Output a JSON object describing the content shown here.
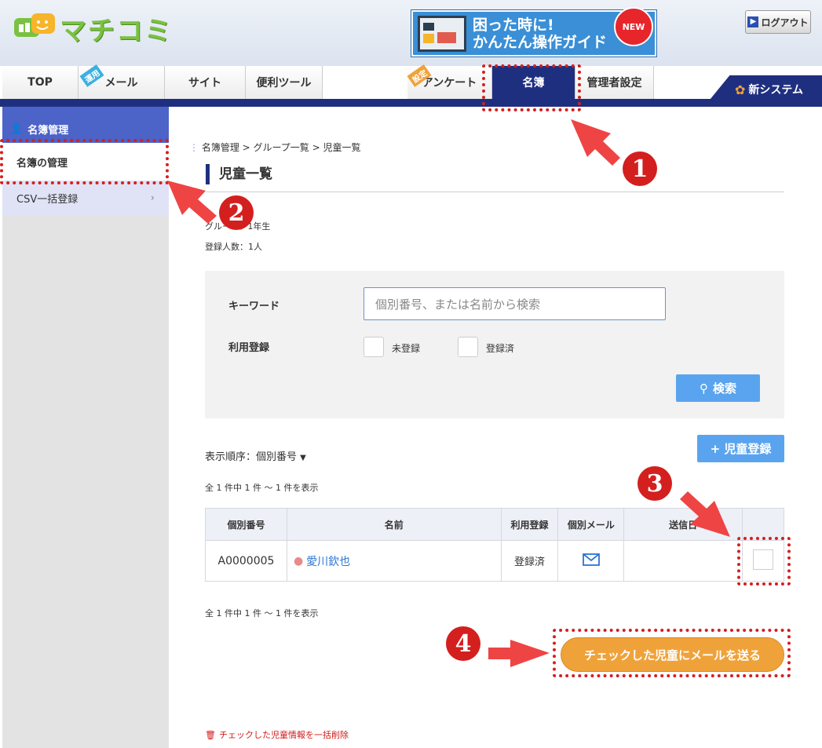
{
  "header": {
    "logo_text": "マチコミ",
    "banner_line1": "困った時に!",
    "banner_line2": "かんたん操作ガイド",
    "banner_badge": "NEW",
    "logout_label": "ログアウト"
  },
  "tabs": {
    "top": "TOP",
    "mail": "メール",
    "mail_badge": "運用",
    "site": "サイト",
    "tools": "便利ツール",
    "survey": "アンケート",
    "survey_badge": "設定",
    "roster": "名簿",
    "admin": "管理者設定",
    "new_system": "新システム"
  },
  "sidebar": {
    "heading": "名簿管理",
    "items": [
      {
        "label": "名簿の管理"
      },
      {
        "label": "CSV一括登録"
      }
    ]
  },
  "breadcrumb": "名簿管理 > グループ一覧 > 児童一覧",
  "page_title": "児童一覧",
  "meta": {
    "group": "グループ：1年生",
    "registered": "登録人数：1人"
  },
  "search": {
    "keyword_label": "キーワード",
    "keyword_placeholder": "個別番号、または名前から検索",
    "usage_label": "利用登録",
    "unregistered": "未登録",
    "registered": "登録済",
    "search_button": "検索"
  },
  "list": {
    "sort_label": "表示順序：個別番号",
    "register_button": "+ 児童登録",
    "count_top": "全 1 件中 1 件 ～ 1 件を表示",
    "count_bottom": "全 1 件中 1 件 ～ 1 件を表示",
    "columns": [
      "個別番号",
      "名前",
      "利用登録",
      "個別メール",
      "送信日",
      ""
    ],
    "rows": [
      {
        "id": "A0000005",
        "name": "愛川欽也",
        "status": "登録済",
        "mail_icon": "mail-icon",
        "sent": ""
      }
    ]
  },
  "send_button": "チェックした児童にメールを送る",
  "delete_link": "チェックした児童情報を一括削除",
  "annotations": [
    "1",
    "2",
    "3",
    "4"
  ],
  "colors": {
    "navy": "#1f2f80",
    "accent_blue": "#5aa4ef",
    "orange": "#f0a23a",
    "annotation_red": "#d41f1f"
  }
}
